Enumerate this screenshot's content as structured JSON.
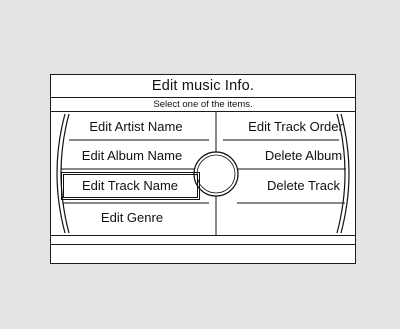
{
  "screen": {
    "title": "Edit music Info.",
    "subtitle": "Select one of the items."
  },
  "menu": {
    "left_items": [
      {
        "label": "Edit Artist Name"
      },
      {
        "label": "Edit Album Name"
      },
      {
        "label": "Edit Track Name"
      },
      {
        "label": "Edit Genre"
      }
    ],
    "right_items": [
      {
        "label": "Edit Track Order"
      },
      {
        "label": "Delete Album"
      },
      {
        "label": "Delete Track"
      }
    ],
    "selected_item": "Edit Track Name"
  }
}
